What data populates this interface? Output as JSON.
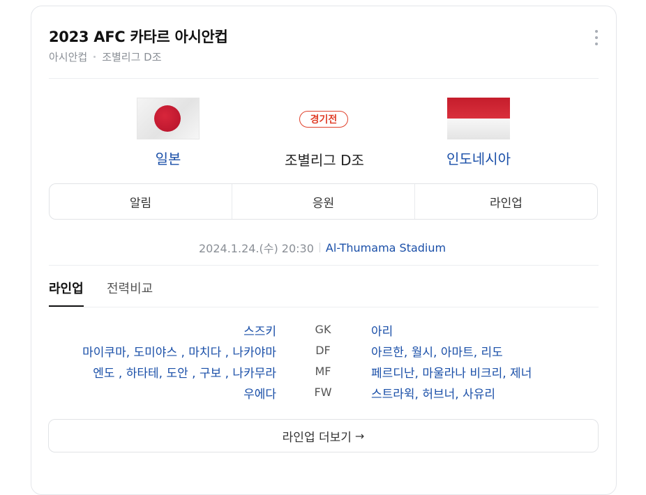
{
  "header": {
    "title": "2023 AFC 카타르 아시안컵",
    "breadcrumb": [
      "아시안컵",
      "조별리그 D조"
    ]
  },
  "match": {
    "home_team": "일본",
    "away_team": "인도네시아",
    "badge": "경기전",
    "group": "조별리그 D조",
    "datetime": "2024.1.24.(수) 20:30",
    "venue": "Al-Thumama Stadium"
  },
  "actions": [
    "알림",
    "응원",
    "라인업"
  ],
  "tabs": {
    "active": "라인업",
    "other": "전력비교"
  },
  "lineup": [
    {
      "pos": "GK",
      "home": "스즈키",
      "away": "아리"
    },
    {
      "pos": "DF",
      "home": "마이쿠마, 도미야스 , 마치다 , 나카야마",
      "away": "아르한, 월시, 아마트, 리도"
    },
    {
      "pos": "MF",
      "home": "엔도 , 하타테, 도안 , 구보 , 나카무라",
      "away": "페르디난, 마울라나 비크리, 제너"
    },
    {
      "pos": "FW",
      "home": "우에다",
      "away": "스트라윅, 허브너, 사유리"
    }
  ],
  "more_label": "라인업 더보기",
  "colors": {
    "link": "#1a4fa8",
    "badge": "#e0402b"
  }
}
